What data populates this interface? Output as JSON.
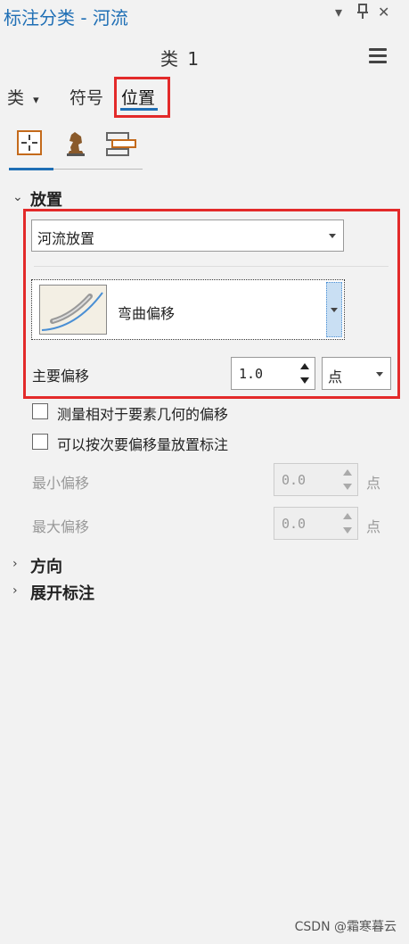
{
  "header": {
    "title": "标注分类 - 河流",
    "pin_glyph": "▾",
    "dock_glyph": "⊥",
    "close_glyph": "✕"
  },
  "class_selector": {
    "label": "类 1"
  },
  "tabs": [
    {
      "label": "类"
    },
    {
      "label": "符号"
    },
    {
      "label": "位置",
      "active": true
    }
  ],
  "tab_dropdown_glyph": "▾",
  "icon_tabs": [
    "position-icon",
    "chess-knight-icon",
    "stack-icon"
  ],
  "placement": {
    "section_label": "放置",
    "dropdown_value": "河流放置",
    "style_value": "弯曲偏移",
    "primary_offset_label": "主要偏移",
    "primary_offset_value": "1.0",
    "unit_value": "点",
    "checkbox1_label": "测量相对于要素几何的偏移",
    "checkbox2_label": "可以按次要偏移量放置标注",
    "min_offset_label": "最小偏移",
    "min_offset_value": "0.0",
    "min_unit": "点",
    "max_offset_label": "最大偏移",
    "max_offset_value": "0.0",
    "max_unit": "点"
  },
  "sections": [
    {
      "label": "方向"
    },
    {
      "label": "展开标注"
    }
  ],
  "watermark": "CSDN @霜寒暮云",
  "colors": {
    "accent": "#1f6fb5",
    "highlight": "#e32a2a"
  }
}
